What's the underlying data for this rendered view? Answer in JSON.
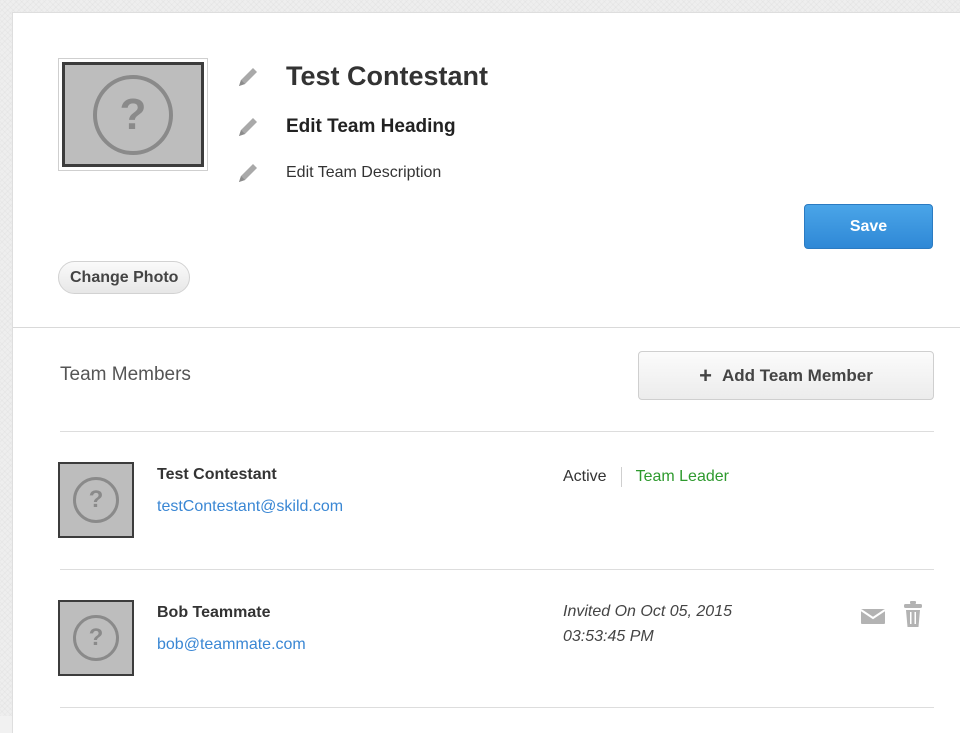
{
  "team": {
    "name": "Test Contestant",
    "heading": "Edit Team Heading",
    "description": "Edit Team Description"
  },
  "buttons": {
    "save": "Save",
    "change_photo": "Change Photo",
    "add_member_icon": "+",
    "add_member": "Add Team Member"
  },
  "members_section": {
    "title": "Team Members"
  },
  "placeholder_glyph": "?",
  "members": [
    {
      "name": "Test Contestant",
      "email": "testContestant@skild.com",
      "status": "Active",
      "role": "Team Leader"
    },
    {
      "name": "Bob Teammate",
      "email": "bob@teammate.com",
      "invited_line1": "Invited On Oct 05, 2015",
      "invited_line2": "03:53:45 PM"
    }
  ],
  "colors": {
    "accent_blue": "#3a87d4",
    "leader_green": "#2e9a2e",
    "save_button": "#3a95e0"
  },
  "icons": {
    "edit": "pencil-icon",
    "mail": "envelope-icon",
    "delete": "trash-icon",
    "placeholder": "question-mark-icon"
  }
}
